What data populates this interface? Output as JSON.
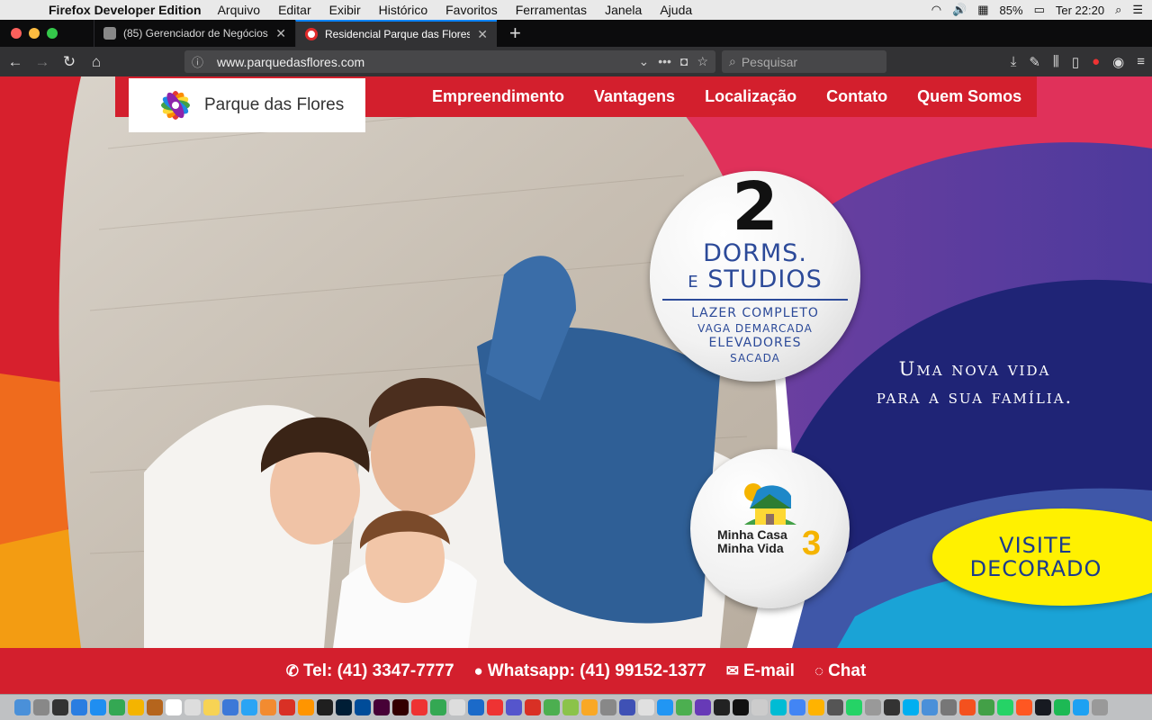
{
  "menubar": {
    "app": "Firefox Developer Edition",
    "items": [
      "Arquivo",
      "Editar",
      "Exibir",
      "Histórico",
      "Favoritos",
      "Ferramentas",
      "Janela",
      "Ajuda"
    ],
    "battery": "85%",
    "clock": "Ter 22:20"
  },
  "tabs": [
    {
      "title": "(85) Gerenciador de Negócios"
    },
    {
      "title": "Residencial Parque das Flores |"
    }
  ],
  "navbar": {
    "url": "www.parquedasflores.com",
    "search_placeholder": "Pesquisar"
  },
  "site": {
    "logo": "Parque das Flores",
    "nav": [
      "Empreendimento",
      "Vantagens",
      "Localização",
      "Contato",
      "Quem Somos"
    ],
    "badge": {
      "number": "2",
      "line1": "Dorms.",
      "line2_small": "e",
      "line2": "Studios",
      "f1": "LAZER COMPLETO",
      "f2": "VAGA DEMARCADA",
      "f3": "ELEVADORES",
      "f4": "SACADA"
    },
    "tagline1": "Uma nova vida",
    "tagline2": "para a sua família.",
    "mcmv_line1": "Minha Casa",
    "mcmv_line2": "Minha Vida",
    "mcmv_num": "3",
    "visite1": "VISITE",
    "visite2": "DECORADO",
    "footer": {
      "tel": "Tel: (41) 3347-7777",
      "whatsapp": "Whatsapp: (41) 99152-1377",
      "email": "E-mail",
      "chat": "Chat"
    }
  },
  "dock_colors": [
    "#4a90d9",
    "#888",
    "#333",
    "#2a7de1",
    "#1f8ef1",
    "#34a853",
    "#f4b400",
    "#b5651d",
    "#fff",
    "#ddd",
    "#f7d354",
    "#3c78d8",
    "#2aa4f4",
    "#f28b30",
    "#d93025",
    "#ff9500",
    "#1f1f1f",
    "#001e36",
    "#004c99",
    "#470137",
    "#330000",
    "#e33",
    "#34a853",
    "#ddd",
    "#1b6ac9",
    "#e33",
    "#55c",
    "#d93025",
    "#4caf50",
    "#8bc34a",
    "#f9a825",
    "#888",
    "#3f51b5",
    "#e0e0e0",
    "#2196f3",
    "#4caf50",
    "#673ab7",
    "#222",
    "#111",
    "#ccc",
    "#00bcd4",
    "#4285f4",
    "#ffb300",
    "#555",
    "#25d366",
    "#999",
    "#333",
    "#00aff0",
    "#4a90d9",
    "#777",
    "#f4511e",
    "#43a047",
    "#25d366",
    "#ff5722",
    "#171a21",
    "#1db954",
    "#1da1f2",
    "#999"
  ]
}
